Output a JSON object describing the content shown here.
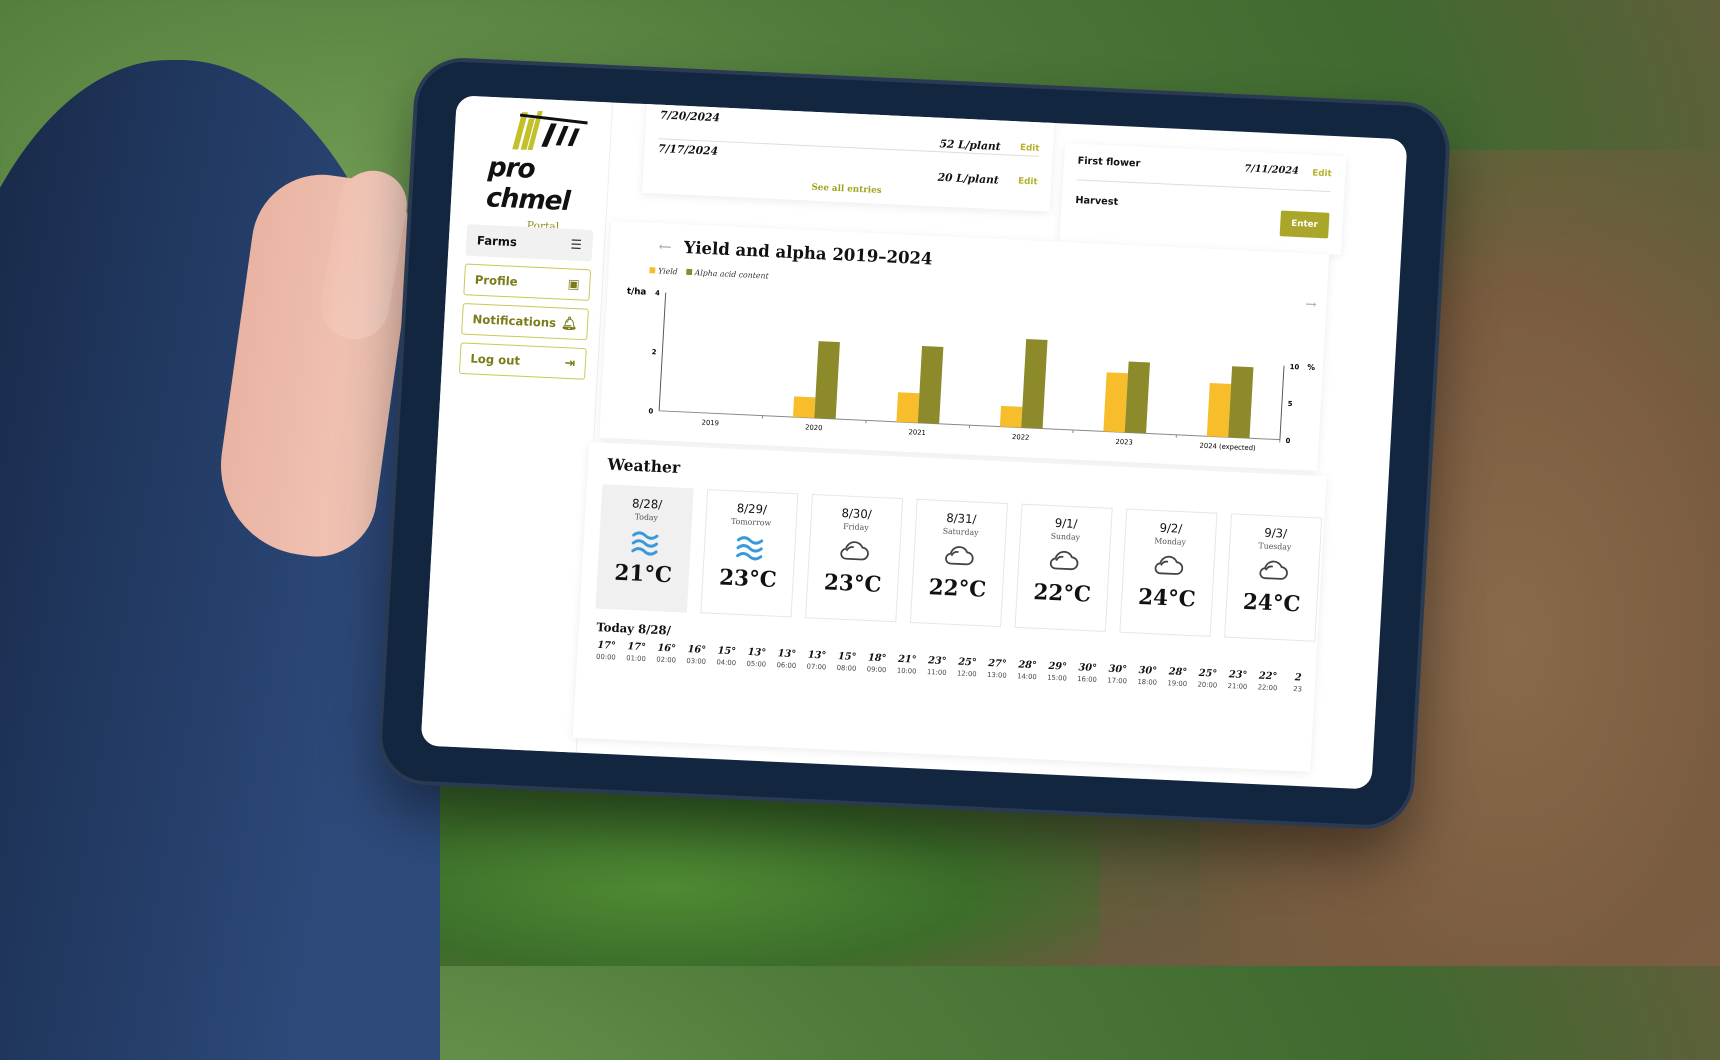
{
  "app": {
    "brand": "pro chmel",
    "subtitle": "Portal"
  },
  "sidebar": {
    "items": [
      {
        "label": "Farms",
        "icon": "farm-icon",
        "active": true
      },
      {
        "label": "Profile",
        "icon": "user-icon",
        "active": false
      },
      {
        "label": "Notifications",
        "icon": "bell-icon",
        "active": false
      },
      {
        "label": "Log out",
        "icon": "logout-icon",
        "active": false
      }
    ]
  },
  "entries": {
    "rows": [
      {
        "date": "7/20/2024",
        "value": "52 L/plant",
        "edit": "Edit"
      },
      {
        "date": "7/17/2024",
        "value": "20 L/plant",
        "edit": "Edit"
      }
    ],
    "see_all": "See all entries"
  },
  "phenology": {
    "rows": [
      {
        "label": "First flower",
        "date": "7/11/2024",
        "edit": "Edit"
      },
      {
        "label": "Harvest",
        "button": "Enter"
      }
    ]
  },
  "colors": {
    "yield": "#f7bd2a",
    "alpha": "#8c8a2a",
    "accent": "#a9a62a",
    "water": "#3a9ad9"
  },
  "chart_data": {
    "type": "bar",
    "title": "Yield and alpha 2019–2024",
    "categories": [
      "2019",
      "2020",
      "2021",
      "2022",
      "2023",
      "2024 (expected)"
    ],
    "series": [
      {
        "name": "Yield",
        "axis": "left",
        "values": [
          0,
          0.7,
          1.0,
          0.7,
          2.0,
          1.8
        ]
      },
      {
        "name": "Alpha acid content",
        "axis": "right",
        "values": [
          0,
          6.5,
          6.5,
          7.5,
          6.0,
          6.0
        ]
      }
    ],
    "ylabel_left": "t/ha",
    "ylim_left": [
      0,
      4
    ],
    "yticks_left": [
      "0",
      "2",
      "4"
    ],
    "ylabel_right": "%",
    "ylim_right": [
      0,
      10
    ],
    "yticks_right": [
      "0",
      "5",
      "10"
    ],
    "legend": "top-left",
    "grid": false
  },
  "weather": {
    "title": "Weather",
    "days": [
      {
        "date": "8/28/",
        "name": "Today",
        "icon": "wind-icon",
        "temp": "21°C"
      },
      {
        "date": "8/29/",
        "name": "Tomorrow",
        "icon": "wind-icon",
        "temp": "23°C"
      },
      {
        "date": "8/30/",
        "name": "Friday",
        "icon": "cloud-icon",
        "temp": "23°C"
      },
      {
        "date": "8/31/",
        "name": "Saturday",
        "icon": "cloud-icon",
        "temp": "22°C"
      },
      {
        "date": "9/1/",
        "name": "Sunday",
        "icon": "cloud-icon",
        "temp": "22°C"
      },
      {
        "date": "9/2/",
        "name": "Monday",
        "icon": "cloud-icon",
        "temp": "24°C"
      },
      {
        "date": "9/3/",
        "name": "Tuesday",
        "icon": "cloud-icon",
        "temp": "24°C"
      }
    ],
    "hourly_title": "Today 8/28/",
    "hourly": [
      {
        "t": "17°",
        "h": "00:00"
      },
      {
        "t": "17°",
        "h": "01:00"
      },
      {
        "t": "16°",
        "h": "02:00"
      },
      {
        "t": "16°",
        "h": "03:00"
      },
      {
        "t": "15°",
        "h": "04:00"
      },
      {
        "t": "13°",
        "h": "05:00"
      },
      {
        "t": "13°",
        "h": "06:00"
      },
      {
        "t": "13°",
        "h": "07:00"
      },
      {
        "t": "15°",
        "h": "08:00"
      },
      {
        "t": "18°",
        "h": "09:00"
      },
      {
        "t": "21°",
        "h": "10:00"
      },
      {
        "t": "23°",
        "h": "11:00"
      },
      {
        "t": "25°",
        "h": "12:00"
      },
      {
        "t": "27°",
        "h": "13:00"
      },
      {
        "t": "28°",
        "h": "14:00"
      },
      {
        "t": "29°",
        "h": "15:00"
      },
      {
        "t": "30°",
        "h": "16:00"
      },
      {
        "t": "30°",
        "h": "17:00"
      },
      {
        "t": "30°",
        "h": "18:00"
      },
      {
        "t": "28°",
        "h": "19:00"
      },
      {
        "t": "25°",
        "h": "20:00"
      },
      {
        "t": "23°",
        "h": "21:00"
      },
      {
        "t": "22°",
        "h": "22:00"
      },
      {
        "t": "2",
        "h": "23"
      }
    ]
  }
}
